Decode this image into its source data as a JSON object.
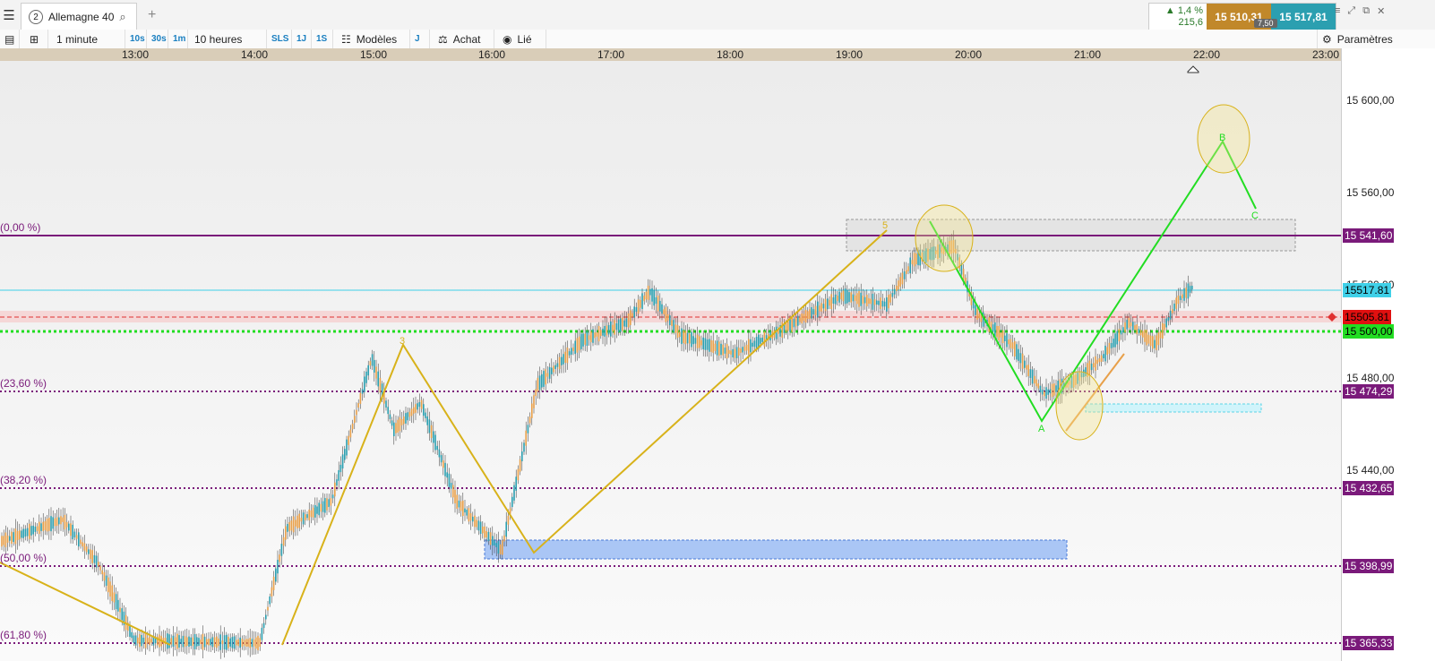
{
  "header": {
    "tab_number": "2",
    "tab_name": "Allemagne 40",
    "change_pct": "▲ 1,4 %",
    "change_abs": "215,6",
    "bid": "15 510,31",
    "ask": "15 517,81",
    "spread": "7,50"
  },
  "toolbar": {
    "timeframe": "1 minute",
    "btn_10s": "10s",
    "btn_30s": "30s",
    "btn_1m": "1m",
    "range": "10 heures",
    "btn_sls": "SLS",
    "btn_1j": "1J",
    "btn_1s": "1S",
    "models": "Modèles",
    "btn_j": "J",
    "buy": "Achat",
    "linked": "Lié",
    "settings": "Paramètres"
  },
  "icons": {
    "menu": "hamburger-icon",
    "search": "search-icon",
    "add": "plus-icon",
    "list": "list-icon",
    "layout": "grid-icon",
    "models": "sliders-icon",
    "buy": "scale-icon",
    "linked": "eye-icon",
    "settings": "gear-icon"
  },
  "time_axis": [
    "13:00",
    "14:00",
    "15:00",
    "16:00",
    "17:00",
    "18:00",
    "19:00",
    "20:00",
    "21:00",
    "22:00",
    "23:00"
  ],
  "price_axis": [
    "15 600,00",
    "15 560,00",
    "15 520,00",
    "15 480,00",
    "15 440,00"
  ],
  "price_tags": {
    "fib0": "15 541,60",
    "ask_line": "15517.81",
    "bid_line": "15505.81",
    "level_15500": "15 500,00",
    "fib236": "15 474,29",
    "fib382": "15 432,65",
    "fib50": "15 398,99",
    "fib618": "15 365,33"
  },
  "fib_labels": [
    "(0,00 %)",
    "(23,60 %)",
    "(38,20 %)",
    "(50,00 %)",
    "(61,80 %)"
  ],
  "wave_labels": {
    "w3": "3",
    "w5": "5",
    "A": "A",
    "B": "B",
    "C": "C"
  },
  "colors": {
    "bid": "#c1882a",
    "ask": "#2b9fb0",
    "fib": "#7a1a7a",
    "wave_yellow": "#d8b21a",
    "wave_green": "#22dd22",
    "up_candle": "#2b9fb0",
    "down_candle": "#e8a04a"
  }
}
